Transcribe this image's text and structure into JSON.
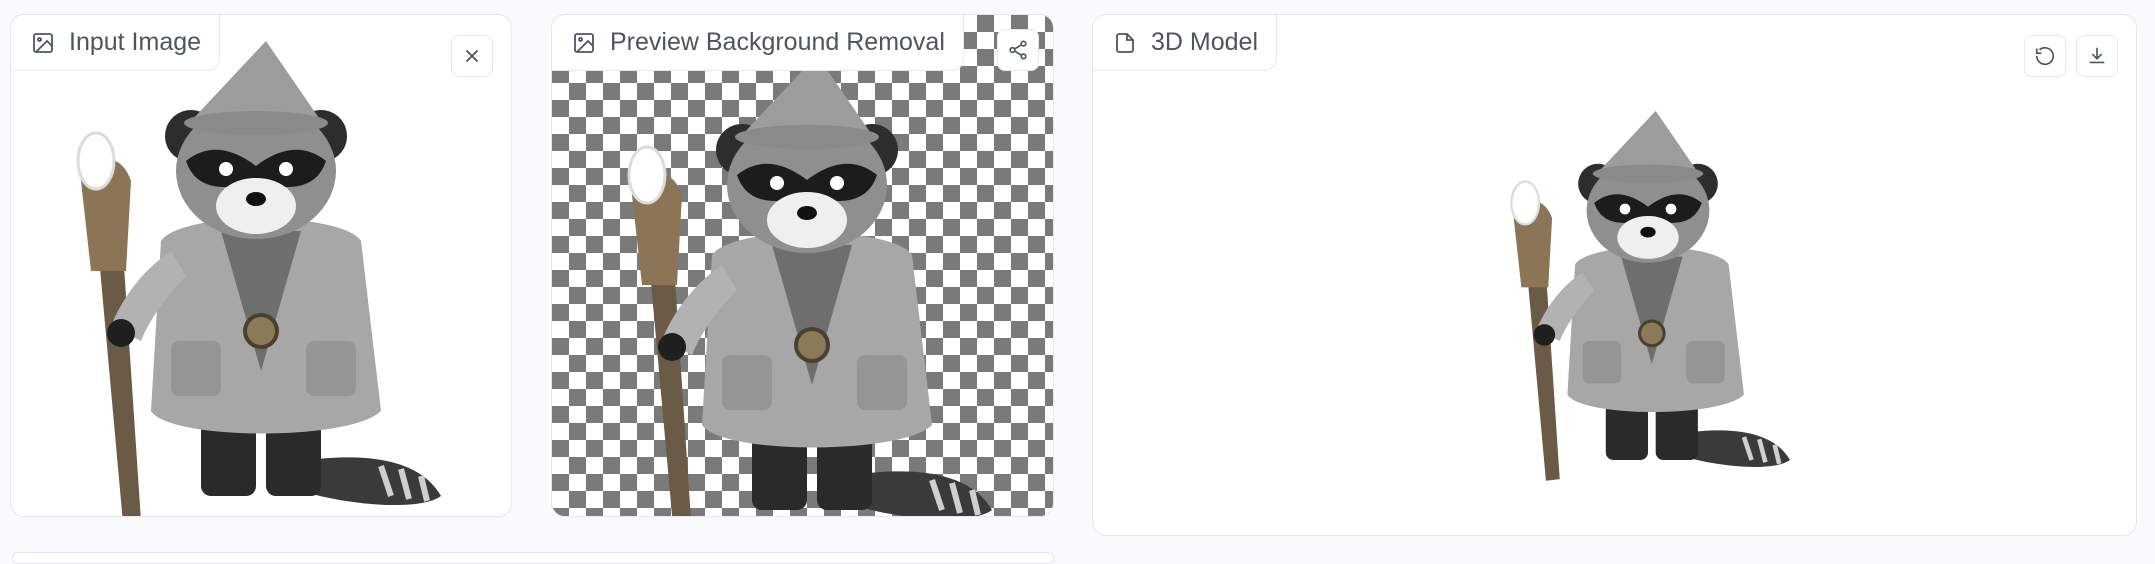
{
  "panels": {
    "input": {
      "label": "Input Image",
      "label_icon": "image-icon",
      "close_icon": "close-icon"
    },
    "preview": {
      "label": "Preview Background Removal",
      "label_icon": "image-icon",
      "share_icon": "share-icon"
    },
    "model": {
      "label": "3D Model",
      "label_icon": "file-icon",
      "reset_icon": "reset-icon",
      "download_icon": "download-icon"
    }
  },
  "colors": {
    "panel_border": "#e5e7eb",
    "label_text": "#4b5563",
    "checker_dark": "#7a7a7a",
    "checker_light": "#ffffff"
  }
}
